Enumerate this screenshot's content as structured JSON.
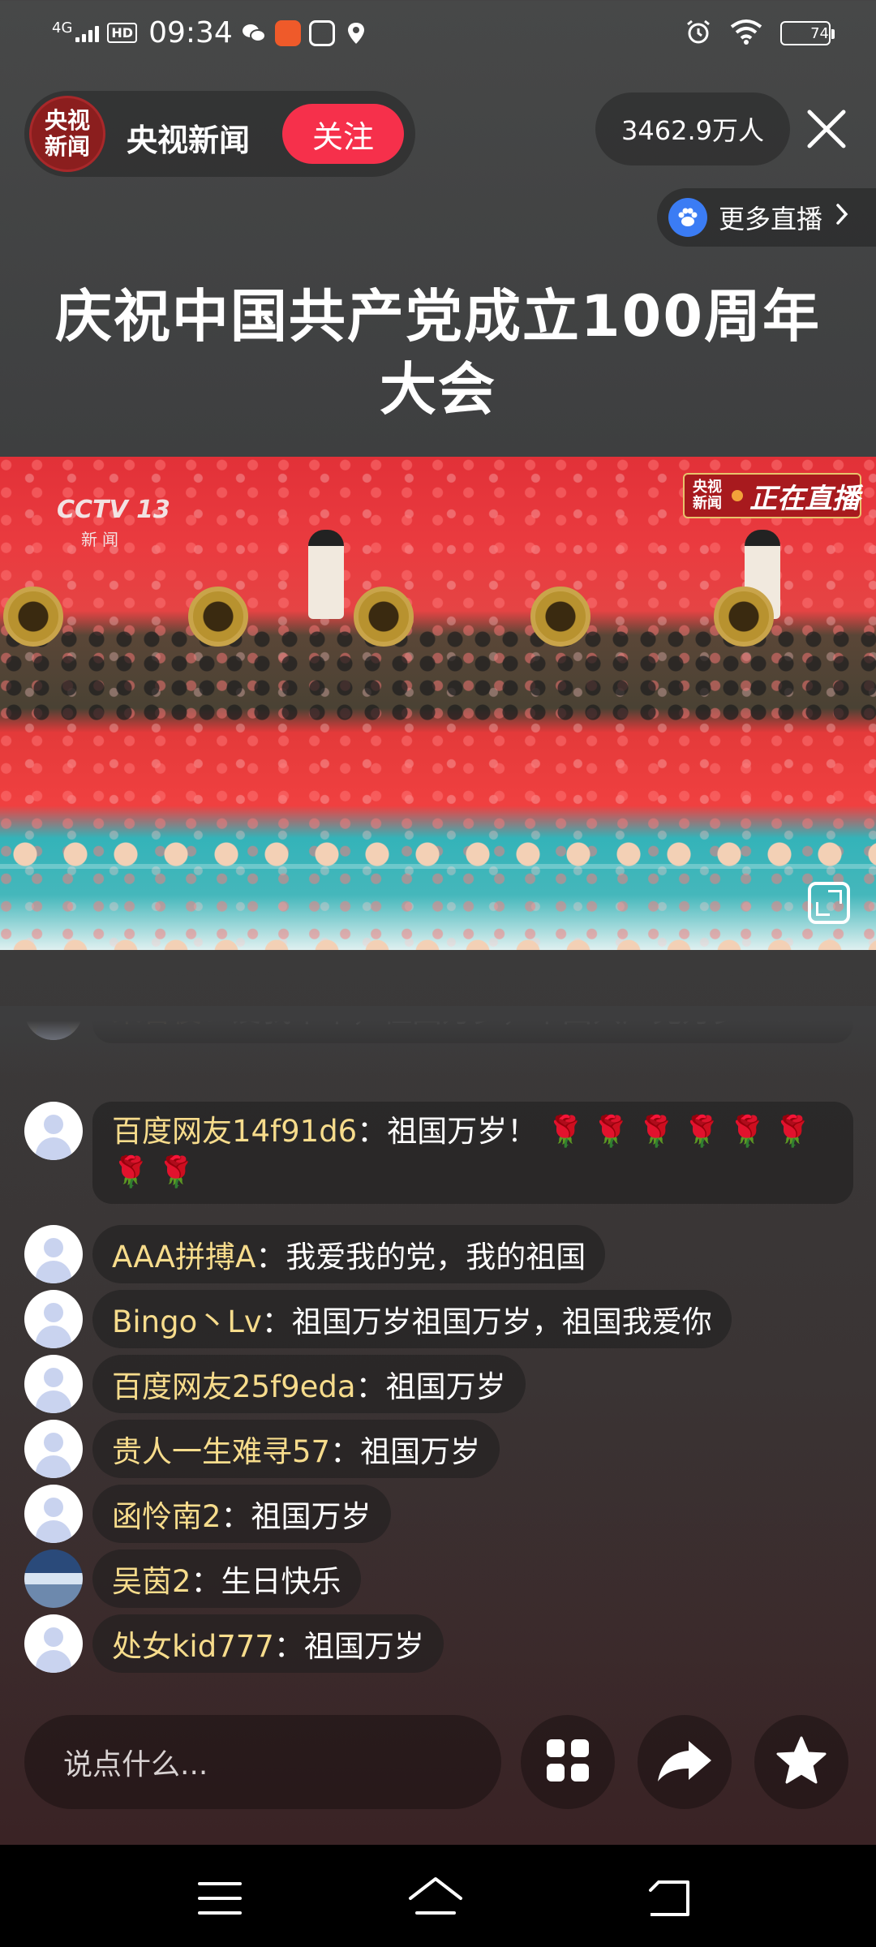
{
  "status_bar": {
    "network": "4G",
    "hd": "HD",
    "time": "09:34",
    "battery": "74",
    "battery_level": 0.74
  },
  "header": {
    "anchor_logo_line1": "央视",
    "anchor_logo_line2": "新闻",
    "anchor_name": "央视新闻",
    "follow_label": "关注",
    "viewer_count": "3462.9万人",
    "more_live_label": "更多直播"
  },
  "title": "庆祝中国共产党成立100周年大会",
  "video": {
    "channel_logo": "CCTV 13",
    "channel_sub": "新闻",
    "badge_logo_line1": "央视",
    "badge_logo_line2": "新闻",
    "badge_text": "正在直播"
  },
  "comments": [
    {
      "user": "荣智俊",
      "text": "爱我中华，祖国万岁，中国共产党万岁！！！"
    },
    {
      "user": "百度网友14f91d6",
      "text": "祖国万岁！",
      "emoji": "🌹🌹🌹🌹🌹🌹🌹🌹"
    },
    {
      "user": "AAA拼搏A",
      "text": "我爱我的党，我的祖国"
    },
    {
      "user": "Bingo丶Lv",
      "text": "祖国万岁祖国万岁，祖国我爱你"
    },
    {
      "user": "百度网友25f9eda",
      "text": "祖国万岁"
    },
    {
      "user": "贵人一生难寻57",
      "text": "祖国万岁"
    },
    {
      "user": "函怜南2",
      "text": "祖国万岁"
    },
    {
      "user": "吴茵2",
      "text": "生日快乐"
    },
    {
      "user": "处女kid777",
      "text": "祖国万岁"
    }
  ],
  "comment_separator": "：",
  "input": {
    "placeholder": "说点什么..."
  },
  "icons": {
    "close": "close-icon",
    "paw": "paw-icon",
    "grid": "grid-icon",
    "share": "share-icon",
    "star": "star-icon",
    "menu": "menu-icon",
    "home": "home-icon",
    "back": "back-icon"
  },
  "colors": {
    "follow": "#f6304b",
    "username": "#f7dc8c",
    "paw": "#3b7cf4"
  }
}
